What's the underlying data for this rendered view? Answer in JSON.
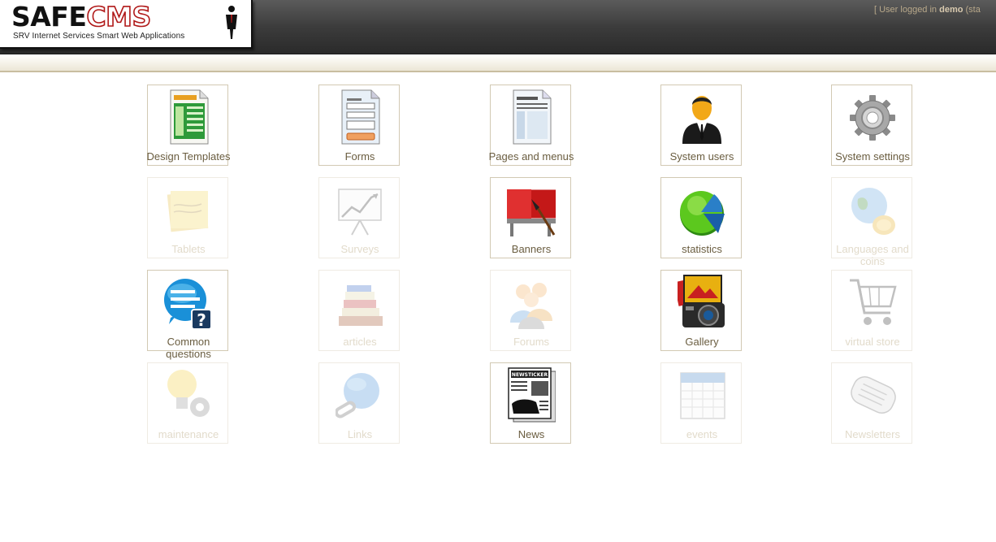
{
  "header": {
    "logo_safe": "SAFE",
    "logo_cms": "CMS",
    "logo_tagline": "SRV Internet Services Smart Web Applications",
    "status_prefix": "[ User logged in ",
    "status_user": "demo",
    "status_suffix": " (sta"
  },
  "modules": [
    {
      "label": "Design Templates",
      "icon": "design-templates-icon",
      "enabled": true
    },
    {
      "label": "Forms",
      "icon": "forms-icon",
      "enabled": true
    },
    {
      "label": "Pages and menus",
      "icon": "pages-menus-icon",
      "enabled": true
    },
    {
      "label": "System users",
      "icon": "system-users-icon",
      "enabled": true
    },
    {
      "label": "System settings",
      "icon": "gear-icon",
      "enabled": true
    },
    {
      "label": "Tablets",
      "icon": "sticky-note-icon",
      "enabled": false
    },
    {
      "label": "Surveys",
      "icon": "chart-board-icon",
      "enabled": false
    },
    {
      "label": "Banners",
      "icon": "billboard-icon",
      "enabled": true
    },
    {
      "label": "statistics",
      "icon": "pie-chart-icon",
      "enabled": true
    },
    {
      "label": "Languages and coins",
      "icon": "globe-coins-icon",
      "enabled": false
    },
    {
      "label": "Common questions",
      "icon": "faq-bubble-icon",
      "enabled": true
    },
    {
      "label": "articles",
      "icon": "books-icon",
      "enabled": false
    },
    {
      "label": "Forums",
      "icon": "people-icon",
      "enabled": false
    },
    {
      "label": "Gallery",
      "icon": "camera-photos-icon",
      "enabled": true
    },
    {
      "label": "virtual store",
      "icon": "shopping-cart-icon",
      "enabled": false
    },
    {
      "label": "maintenance",
      "icon": "bulb-gear-icon",
      "enabled": false
    },
    {
      "label": "Links",
      "icon": "globe-chain-icon",
      "enabled": false
    },
    {
      "label": "News",
      "icon": "newspaper-icon",
      "enabled": true
    },
    {
      "label": "events",
      "icon": "calendar-icon",
      "enabled": false
    },
    {
      "label": "Newsletters",
      "icon": "rolled-newspaper-icon",
      "enabled": false
    }
  ]
}
